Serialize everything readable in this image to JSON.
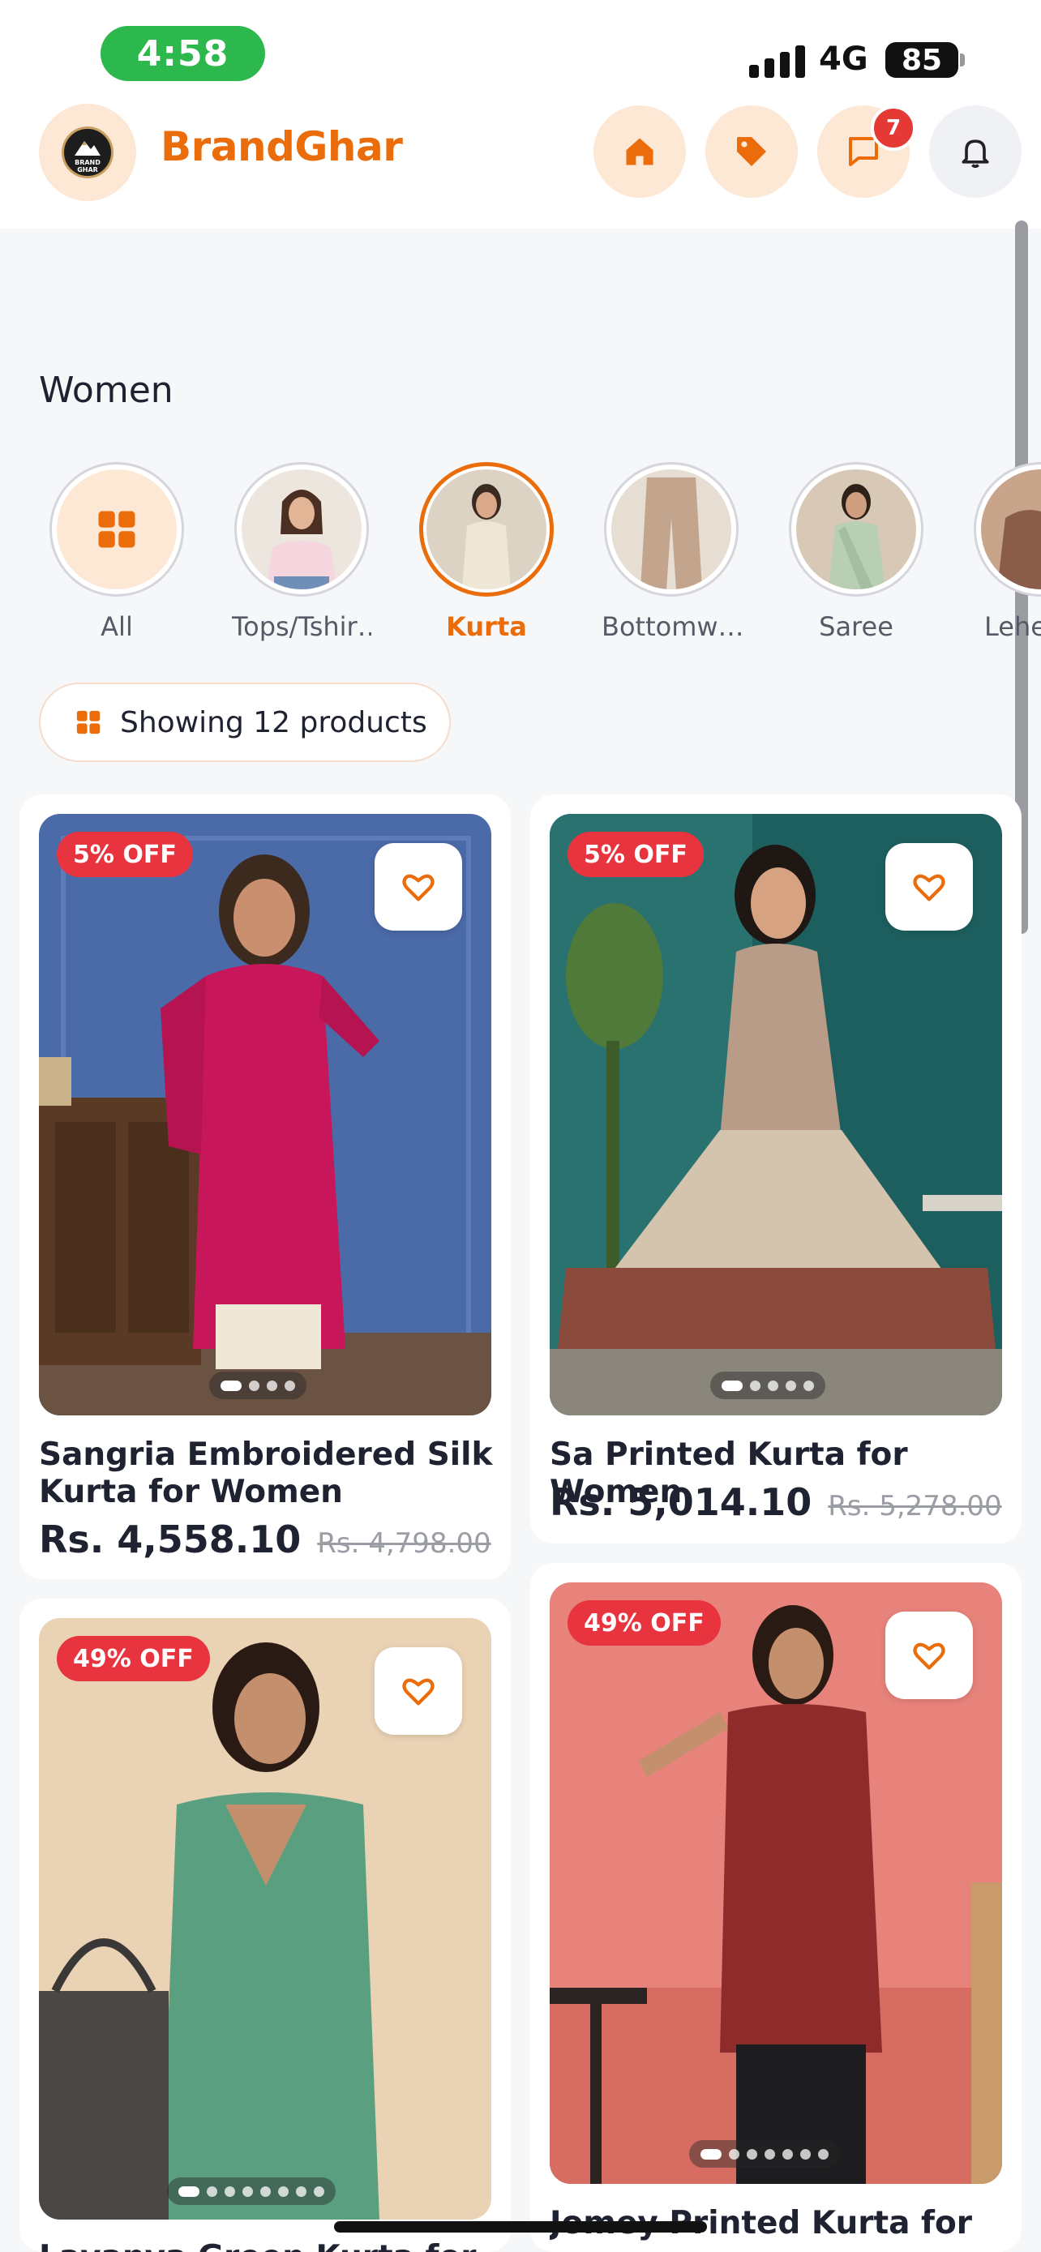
{
  "status_bar": {
    "time": "4:58",
    "network": "4G",
    "battery": "85"
  },
  "header": {
    "brand_name": "BrandGhar",
    "logo_text": "BRAND GHAR",
    "messages_badge": "7",
    "icons": [
      "home-icon",
      "tag-icon",
      "message-icon",
      "bell-icon"
    ]
  },
  "section": {
    "title": "Women"
  },
  "categories": [
    {
      "label": "All",
      "active": false
    },
    {
      "label": "Tops/Tshir…",
      "active": false
    },
    {
      "label": "Kurta",
      "active": true
    },
    {
      "label": "Bottomw…",
      "active": false
    },
    {
      "label": "Saree",
      "active": false
    },
    {
      "label": "Lehe",
      "active": false
    }
  ],
  "results": {
    "count_text": "Showing 12 products"
  },
  "products": [
    {
      "name": "Sangria Embroidered Silk Kurta for Women",
      "price": "Rs. 4,558.10",
      "mrp": "Rs. 4,798.00",
      "discount": "5% OFF",
      "image_count": 4,
      "wishlisted": false
    },
    {
      "name": "Sa Printed Kurta for Women",
      "price": "Rs. 5,014.10",
      "mrp": "Rs. 5,278.00",
      "discount": "5% OFF",
      "image_count": 5,
      "wishlisted": false
    },
    {
      "name": "Lavanya Green Kurta for",
      "price": "",
      "mrp": "",
      "discount": "49% OFF",
      "image_count": 8,
      "wishlisted": false
    },
    {
      "name": "Jomey Printed Kurta for",
      "price": "",
      "mrp": "",
      "discount": "49% OFF",
      "image_count": 7,
      "wishlisted": false
    }
  ],
  "colors": {
    "accent": "#ea6c0a",
    "accent_soft": "#fde8d6",
    "discount": "#e8343f",
    "text": "#1f2230"
  }
}
